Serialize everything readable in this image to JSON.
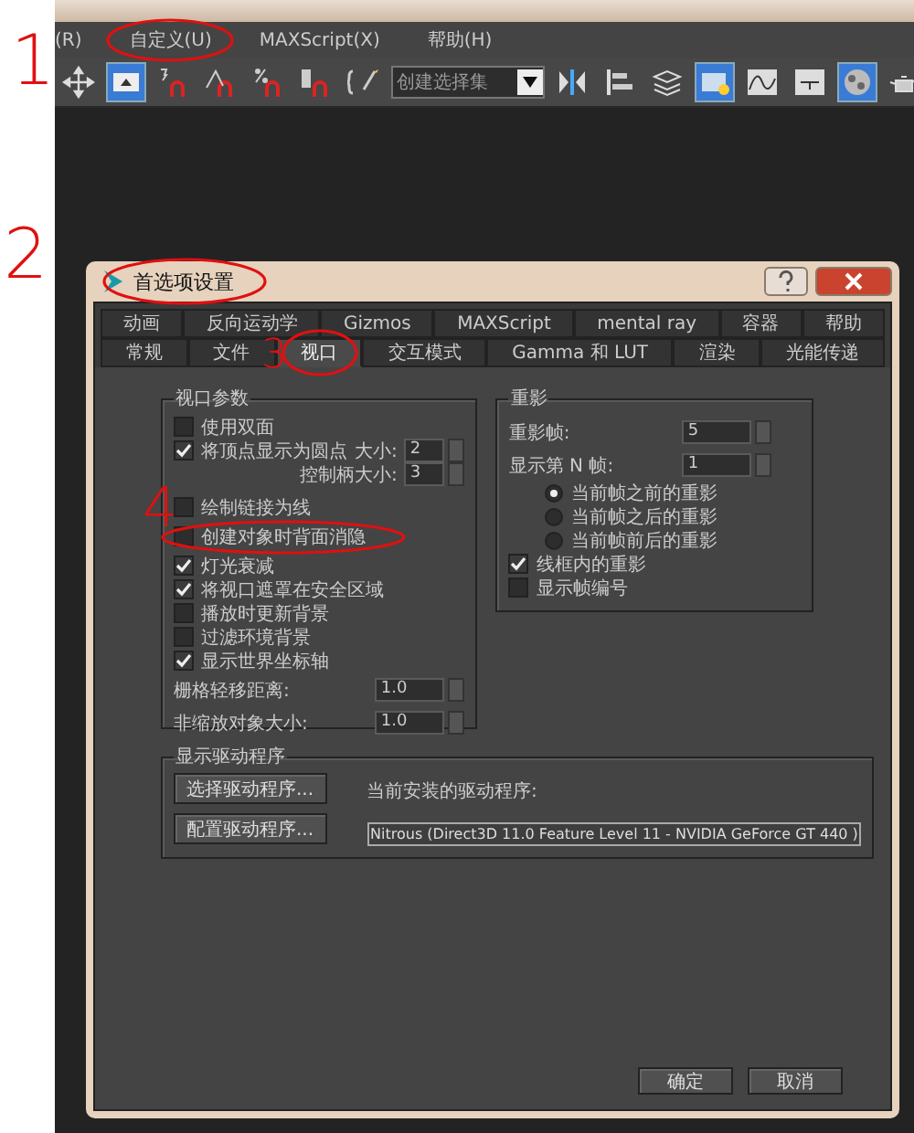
{
  "menu_bar": [
    "(R)",
    "自定义(U)",
    "MAXScript(X)",
    "帮助(H)"
  ],
  "toolbar": {
    "items": [
      {
        "kind": "move",
        "selected": false
      },
      {
        "kind": "select",
        "selected": true
      },
      {
        "kind": "snap",
        "selected": false
      },
      {
        "kind": "angle_snap",
        "selected": false
      },
      {
        "kind": "percent_snap",
        "selected": false
      },
      {
        "kind": "spinner_snap",
        "selected": false
      },
      {
        "kind": "edit_set",
        "selected": false
      },
      {
        "kind": "dropdown",
        "value": "创建选择集"
      },
      {
        "kind": "mirror",
        "selected": false
      },
      {
        "kind": "align",
        "selected": false
      },
      {
        "kind": "layers",
        "selected": false
      },
      {
        "kind": "explorer",
        "selected": true
      },
      {
        "kind": "curve",
        "selected": false
      },
      {
        "kind": "schematic",
        "selected": false
      },
      {
        "kind": "material",
        "selected": true
      },
      {
        "kind": "teapot",
        "selected": false
      }
    ]
  },
  "dialog": {
    "title": "首选项设置",
    "tab_rows": [
      [
        {
          "label": "动画",
          "selected": false
        },
        {
          "label": "反向运动学",
          "selected": false
        },
        {
          "label": "Gizmos",
          "selected": false
        },
        {
          "label": "MAXScript",
          "selected": false
        },
        {
          "label": "mental ray",
          "selected": false
        },
        {
          "label": "容器",
          "selected": false
        },
        {
          "label": "帮助",
          "selected": false
        }
      ],
      [
        {
          "label": "常规",
          "selected": false
        },
        {
          "label": "文件",
          "selected": false
        },
        {
          "label": "视口",
          "selected": true
        },
        {
          "label": "交互模式",
          "selected": false
        },
        {
          "label": "Gamma 和 LUT",
          "selected": false
        },
        {
          "label": "渲染",
          "selected": false
        },
        {
          "label": "光能传递",
          "selected": false
        }
      ]
    ],
    "viewport_parameters": {
      "title": "视口参数",
      "items": [
        {
          "kind": "checkbox",
          "label": "使用双面",
          "checked": false
        },
        {
          "kind": "checkbox",
          "label": "将顶点显示为圆点",
          "checked": true,
          "spinner": {
            "label": "大小:",
            "value": "2"
          }
        },
        {
          "kind": "sub_spinner",
          "label": "控制柄大小:",
          "value": "3"
        },
        {
          "kind": "checkbox",
          "label": "绘制链接为线",
          "checked": false
        },
        {
          "kind": "checkbox",
          "label": "创建对象时背面消隐",
          "checked": false
        },
        {
          "kind": "checkbox",
          "label": "灯光衰减",
          "checked": true
        },
        {
          "kind": "checkbox",
          "label": "将视口遮罩在安全区域",
          "checked": true
        },
        {
          "kind": "checkbox",
          "label": "播放时更新背景",
          "checked": false
        },
        {
          "kind": "checkbox",
          "label": "过滤环境背景",
          "checked": false
        },
        {
          "kind": "checkbox",
          "label": "显示世界坐标轴",
          "checked": true
        },
        {
          "kind": "spinner",
          "label": "栅格轻移距离:",
          "value": "1.0"
        },
        {
          "kind": "spinner",
          "label": "非缩放对象大小:",
          "value": "1.0"
        }
      ]
    },
    "ghosting": {
      "title": "重影",
      "items": [
        {
          "kind": "spinner",
          "label": "重影帧:",
          "value": "5"
        },
        {
          "kind": "spinner",
          "label": "显示第 N 帧:",
          "value": "1"
        },
        {
          "kind": "radio",
          "label": "当前帧之前的重影",
          "selected": true
        },
        {
          "kind": "radio",
          "label": "当前帧之后的重影",
          "selected": false
        },
        {
          "kind": "radio",
          "label": "当前帧前后的重影",
          "selected": false
        },
        {
          "kind": "checkbox",
          "label": "线框内的重影",
          "checked": true
        },
        {
          "kind": "checkbox",
          "label": "显示帧编号",
          "checked": false
        }
      ]
    },
    "display_driver": {
      "title": "显示驱动程序",
      "buttons": [
        "选择驱动程序...",
        "配置驱动程序..."
      ],
      "current_label": "当前安装的驱动程序:",
      "current_value": "Nitrous (Direct3D 11.0 Feature Level 11 - NVIDIA GeForce GT 440 )"
    },
    "buttons": [
      "确定",
      "取消"
    ]
  },
  "annotations": [
    "1",
    "2",
    "3",
    "4"
  ]
}
